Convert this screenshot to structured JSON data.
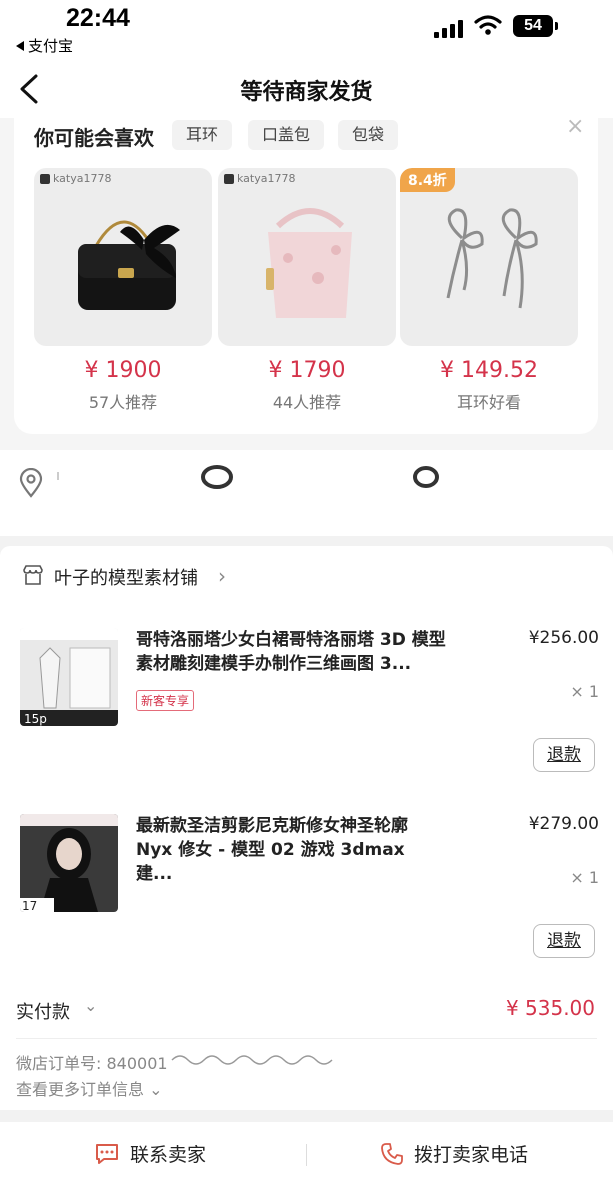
{
  "status_bar": {
    "time": "22:44",
    "back_app": "支付宝",
    "battery": "54"
  },
  "nav": {
    "title": "等待商家发货"
  },
  "recommend": {
    "title": "你可能会喜欢",
    "tags": [
      "耳环",
      "口盖包",
      "包袋"
    ],
    "products": [
      {
        "shop": "katya1778",
        "price": "¥ 1900",
        "sub": "57人推荐"
      },
      {
        "shop": "katya1778",
        "price": "¥ 1790",
        "sub": "44人推荐"
      },
      {
        "discount": "8.4折",
        "price": "¥ 149.52",
        "sub": "耳环好看"
      }
    ]
  },
  "shop": {
    "name": "叶子的模型素材铺"
  },
  "items": [
    {
      "title": "哥特洛丽塔少女白裙哥特洛丽塔 3D 模型素材雕刻建模手办制作三维画图 3...",
      "price": "¥256.00",
      "qty": "× 1",
      "badge": "新客专享",
      "refund": "退款",
      "thumb_text": "15p"
    },
    {
      "title": "最新款圣洁剪影尼克斯修女神圣轮廓 Nyx 修女 - 模型 02 游戏 3dmax 建...",
      "price": "¥279.00",
      "qty": "× 1",
      "refund": "退款",
      "thumb_text": "17"
    }
  ],
  "payment": {
    "label": "实付款",
    "amount": "¥ 535.00",
    "order_no": "微店订单号: 840001",
    "more": "查看更多订单信息"
  },
  "footer": {
    "contact": "联系卖家",
    "call": "拨打卖家电话"
  },
  "colors": {
    "price_red": "#d4334a",
    "discount_orange": "#f0a54a"
  }
}
